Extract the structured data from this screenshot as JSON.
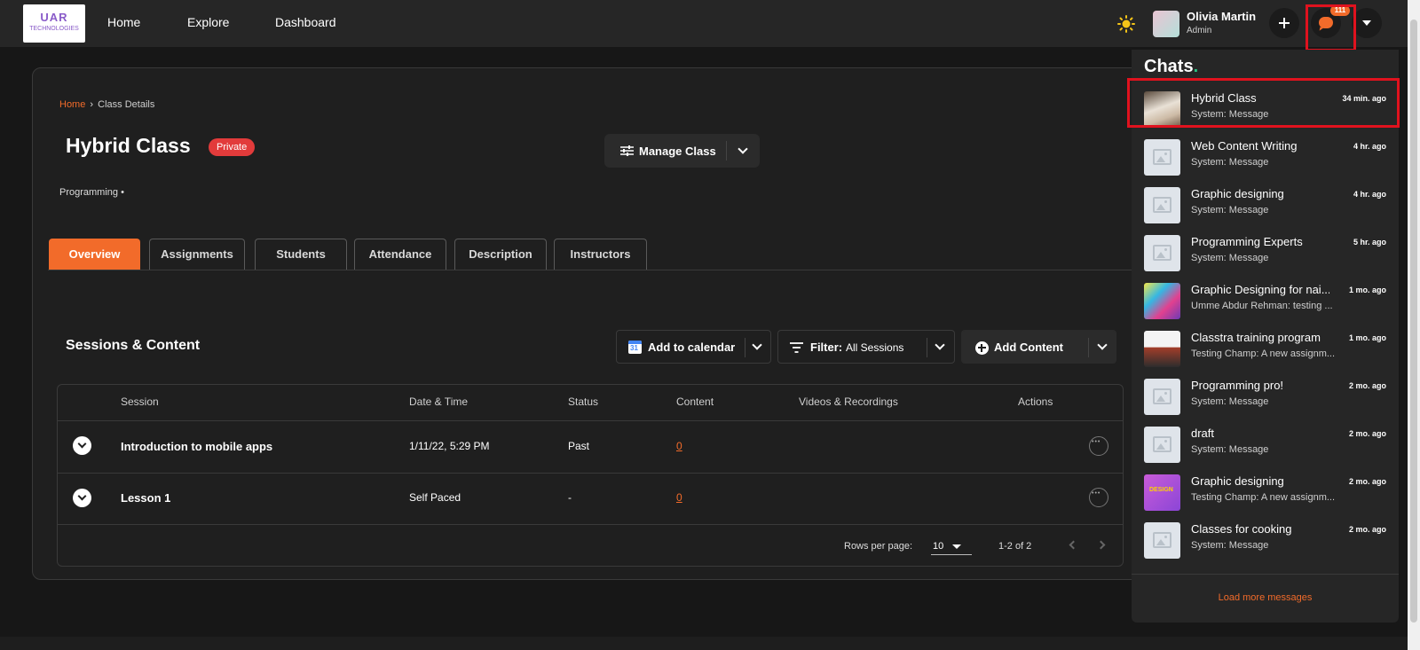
{
  "brand": {
    "logo_line1": "UAR",
    "logo_line2": "TECHNOLOGIES"
  },
  "nav": {
    "links": [
      "Home",
      "Explore",
      "Dashboard"
    ]
  },
  "user": {
    "name": "Olivia Martin",
    "role": "Admin"
  },
  "notifications": {
    "chat_count": "111"
  },
  "breadcrumb": {
    "home": "Home",
    "separator": "›",
    "current": "Class Details"
  },
  "class": {
    "title": "Hybrid Class",
    "privacy_badge": "Private",
    "category": "Programming •"
  },
  "manage": {
    "label": "Manage Class"
  },
  "tabs": [
    "Overview",
    "Assignments",
    "Students",
    "Attendance",
    "Description",
    "Instructors"
  ],
  "active_tab": "Overview",
  "sessions": {
    "title": "Sessions & Content",
    "add_calendar": "Add to calendar",
    "filter_label": "Filter:",
    "filter_value": "All Sessions",
    "add_content": "Add Content",
    "columns": [
      "Session",
      "Date & Time",
      "Status",
      "Content",
      "Videos & Recordings",
      "Actions"
    ],
    "rows": [
      {
        "session": "Introduction to mobile apps",
        "datetime": "1/11/22, 5:29 PM",
        "status": "Past",
        "content": "0"
      },
      {
        "session": "Lesson 1",
        "datetime": "Self Paced",
        "status": "-",
        "content": "0"
      }
    ],
    "rows_per_page_label": "Rows per page:",
    "rows_per_page": "10",
    "range": "1-2 of 2"
  },
  "chats": {
    "title": "Chats",
    "title_dot": ".",
    "items": [
      {
        "name": "Hybrid Class",
        "message": "System: Message",
        "time": "34 min. ago",
        "thumb": "photo-class"
      },
      {
        "name": "Web Content Writing",
        "message": "System: Message",
        "time": "4 hr. ago",
        "thumb": "placeholder"
      },
      {
        "name": "Graphic designing",
        "message": "System: Message",
        "time": "4 hr. ago",
        "thumb": "placeholder"
      },
      {
        "name": "Programming Experts",
        "message": "System: Message",
        "time": "5 hr. ago",
        "thumb": "placeholder"
      },
      {
        "name": "Graphic Designing for nai...",
        "message": "Umme Abdur Rehman: testing ...",
        "time": "1 mo. ago",
        "thumb": "photo-colorful"
      },
      {
        "name": "Classtra training program",
        "message": "Testing Champ: A new assignm...",
        "time": "1 mo. ago",
        "thumb": "photo-training"
      },
      {
        "name": "Programming pro!",
        "message": "System: Message",
        "time": "2 mo. ago",
        "thumb": "placeholder"
      },
      {
        "name": "draft",
        "message": "System: Message",
        "time": "2 mo. ago",
        "thumb": "placeholder"
      },
      {
        "name": "Graphic designing",
        "message": "Testing Champ: A new assignm...",
        "time": "2 mo. ago",
        "thumb": "photo-design"
      },
      {
        "name": "Classes for cooking",
        "message": "System: Message",
        "time": "2 mo. ago",
        "thumb": "placeholder"
      }
    ],
    "design_thumb_text": "DESIGN",
    "load_more": "Load more messages"
  },
  "colors": {
    "accent": "#f26b2a",
    "highlight": "#e0121e",
    "private_badge": "#e23b3b",
    "online_dot": "#26c281"
  },
  "icons": [
    "sun-icon",
    "plus-icon",
    "chat-bubble-icon",
    "chevron-down-icon",
    "sliders-icon",
    "google-calendar-icon",
    "filter-icon",
    "plus-circle-icon",
    "more-horizontal-icon",
    "image-placeholder-icon"
  ]
}
